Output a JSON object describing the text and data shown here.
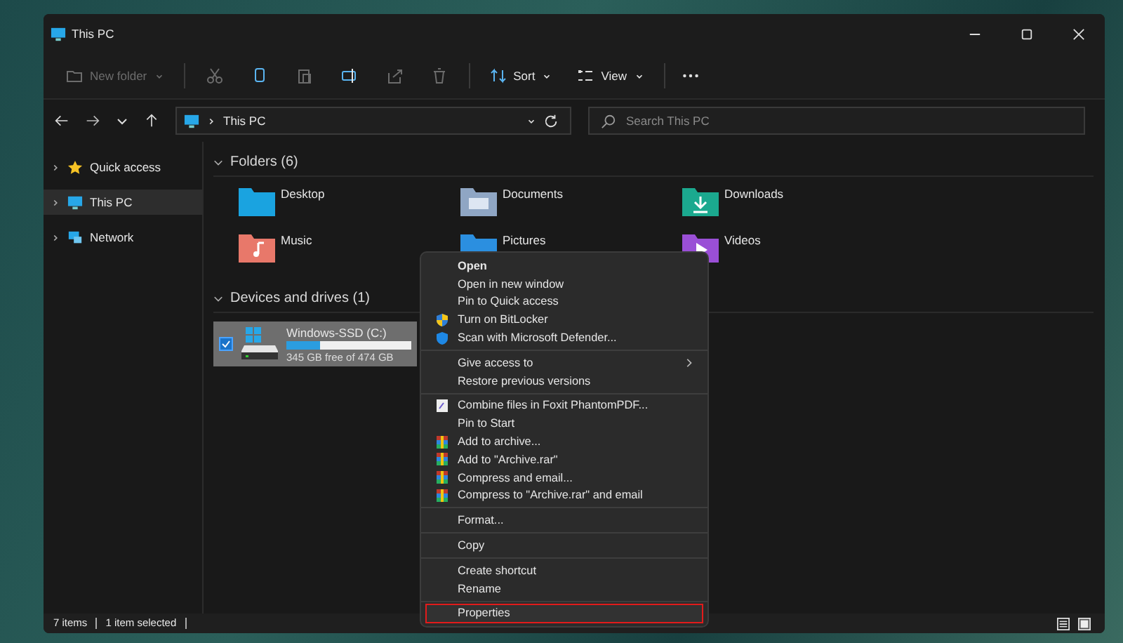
{
  "window": {
    "title": "This PC"
  },
  "toolbar": {
    "new_folder": {
      "label": "New folder",
      "disabled": true
    },
    "actions": [
      {
        "kind": "cut",
        "disabled": true
      },
      {
        "kind": "copy",
        "disabled": false
      },
      {
        "kind": "paste",
        "disabled": true
      },
      {
        "kind": "rename",
        "disabled": false
      },
      {
        "kind": "share",
        "disabled": true
      },
      {
        "kind": "delete",
        "disabled": true
      }
    ],
    "sort": "Sort",
    "view": "View"
  },
  "address_bar": {
    "path": "This PC",
    "search": {
      "placeholder": "Search This PC"
    }
  },
  "sidebar": {
    "items": [
      {
        "label": "Quick access",
        "kind": "star",
        "selected": false
      },
      {
        "label": "This PC",
        "kind": "pc",
        "selected": true
      },
      {
        "label": "Network",
        "kind": "network",
        "selected": false
      }
    ]
  },
  "folders": {
    "title": "Folders (6)",
    "expanded": true,
    "items": [
      {
        "name": "Desktop",
        "kind": "desktop"
      },
      {
        "name": "Documents",
        "kind": "documents"
      },
      {
        "name": "Downloads",
        "kind": "downloads"
      },
      {
        "name": "Music",
        "kind": "music"
      },
      {
        "name": "Pictures",
        "kind": "pictures"
      },
      {
        "name": "Videos",
        "kind": "videos"
      }
    ]
  },
  "drives": {
    "title": "Devices and drives (1)",
    "expanded": true,
    "items": [
      {
        "name": "Windows-SSD (C:)",
        "free": "345 GB free of 474 GB",
        "level": 0.27,
        "selected": true,
        "checked": true
      }
    ]
  },
  "context_menu": {
    "groups": [
      [
        {
          "label": "Open",
          "bold": true,
          "kind": "plain",
          "submenu": false,
          "highlighted": false
        },
        {
          "label": "Open in new window",
          "bold": false,
          "kind": "plain",
          "submenu": false,
          "highlighted": false
        },
        {
          "label": "Pin to Quick access",
          "bold": false,
          "kind": "plain",
          "submenu": false,
          "highlighted": false
        },
        {
          "label": "Turn on BitLocker",
          "bold": false,
          "kind": "security",
          "submenu": false,
          "highlighted": false
        },
        {
          "label": "Scan with Microsoft Defender...",
          "bold": false,
          "kind": "defender",
          "submenu": false,
          "highlighted": false
        }
      ],
      [
        {
          "label": "Give access to",
          "bold": false,
          "kind": "plain",
          "submenu": true,
          "highlighted": false
        },
        {
          "label": "Restore previous versions",
          "bold": false,
          "kind": "plain",
          "submenu": false,
          "highlighted": false
        }
      ],
      [
        {
          "label": "Combine files in Foxit PhantomPDF...",
          "bold": false,
          "kind": "pdf",
          "submenu": false,
          "highlighted": false
        },
        {
          "label": "Pin to Start",
          "bold": false,
          "kind": "plain",
          "submenu": false,
          "highlighted": false
        },
        {
          "label": "Add to archive...",
          "bold": false,
          "kind": "archive",
          "submenu": false,
          "highlighted": false
        },
        {
          "label": "Add to \"Archive.rar\"",
          "bold": false,
          "kind": "archive",
          "submenu": false,
          "highlighted": false
        },
        {
          "label": "Compress and email...",
          "bold": false,
          "kind": "archive",
          "submenu": false,
          "highlighted": false
        },
        {
          "label": "Compress to \"Archive.rar\" and email",
          "bold": false,
          "kind": "archive",
          "submenu": false,
          "highlighted": false
        }
      ],
      [
        {
          "label": "Format...",
          "bold": false,
          "kind": "plain",
          "submenu": false,
          "highlighted": false
        }
      ],
      [
        {
          "label": "Copy",
          "bold": false,
          "kind": "plain",
          "submenu": false,
          "highlighted": false
        }
      ],
      [
        {
          "label": "Create shortcut",
          "bold": false,
          "kind": "plain",
          "submenu": false,
          "highlighted": false
        },
        {
          "label": "Rename",
          "bold": false,
          "kind": "plain",
          "submenu": false,
          "highlighted": false
        }
      ],
      [
        {
          "label": "Properties",
          "bold": false,
          "kind": "plain",
          "submenu": false,
          "highlighted": true
        }
      ]
    ]
  },
  "status_bar": {
    "count": "7 items",
    "selection": "1 item selected"
  }
}
